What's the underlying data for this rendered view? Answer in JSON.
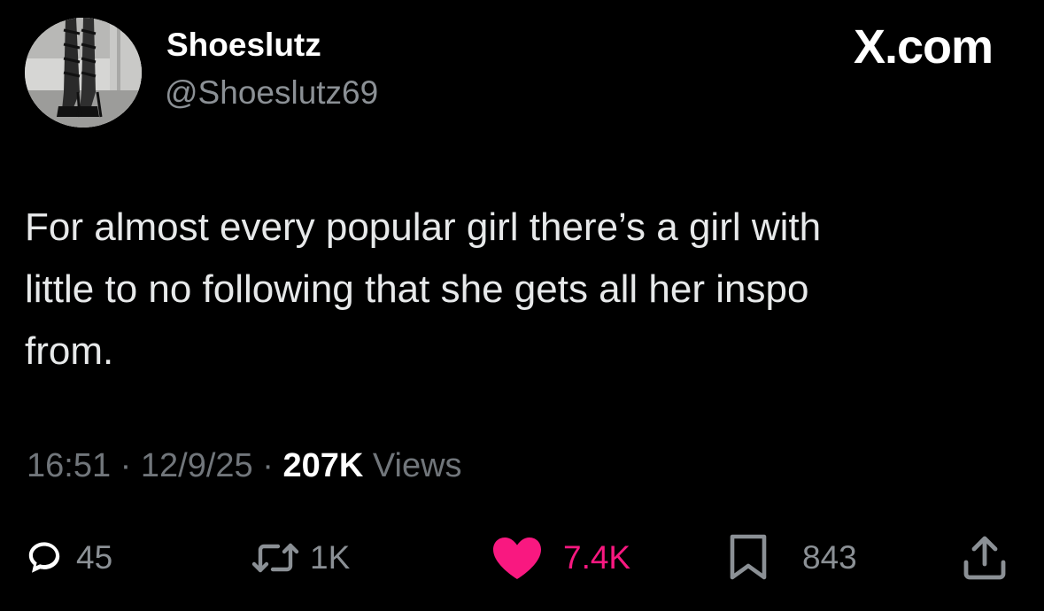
{
  "header": {
    "display_name": "Shoeslutz",
    "handle": "@Shoeslutz69",
    "brand": "X.com",
    "avatar_icon": "avatar-photo-icon"
  },
  "tweet": {
    "text_lines": [
      "For almost every popular girl there’s a girl with",
      "little to no following that she gets all her inspo",
      "from."
    ]
  },
  "meta": {
    "time": "16:51",
    "sep1": " · ",
    "date": "12/9/25",
    "sep2": " · ",
    "views_count": "207K",
    "views_label": " Views"
  },
  "actions": {
    "reply": {
      "icon": "reply-icon",
      "count": "45"
    },
    "retweet": {
      "icon": "retweet-icon",
      "count": "1K"
    },
    "like": {
      "icon": "heart-icon",
      "count": "7.4K",
      "color": "#f91880"
    },
    "bookmark": {
      "icon": "bookmark-icon",
      "count": "843"
    },
    "share": {
      "icon": "share-icon"
    }
  },
  "colors": {
    "background": "#000000",
    "primary_text": "#e7e9ea",
    "secondary_text": "#71767b",
    "like": "#f91880"
  }
}
